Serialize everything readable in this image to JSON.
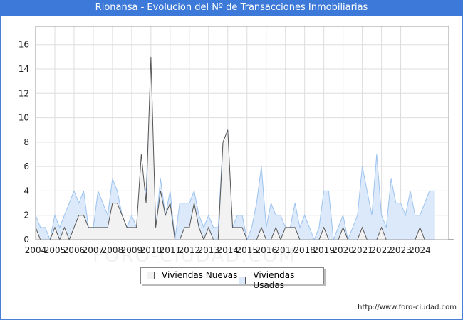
{
  "title": "Rionansa - Evolucion del Nº de Transacciones Inmobiliarias",
  "source": "http://www.foro-ciudad.com",
  "watermark": "FORO-CIUDAD.COM",
  "colors": {
    "title_bg": "#3c79d8",
    "nuevas_fill": "#f2f2f2",
    "nuevas_line": "#555555",
    "usadas_fill": "#dbe9fb",
    "usadas_line": "#9cc3ef",
    "grid": "#dddddd"
  },
  "legend": [
    {
      "label": "Viviendas Nuevas",
      "key": "nuevas"
    },
    {
      "label": "Viviendas Usadas",
      "key": "usadas"
    }
  ],
  "chart_data": {
    "type": "area",
    "title": "Rionansa - Evolucion del Nº de Transacciones Inmobiliarias",
    "xlabel": "",
    "ylabel": "",
    "x_ticks": [
      "2004",
      "2005",
      "2006",
      "2007",
      "2008",
      "2009",
      "2010",
      "2011",
      "2012",
      "2013",
      "2014",
      "2015",
      "2016",
      "2017",
      "2018",
      "2019",
      "2020",
      "2021",
      "2022",
      "2023",
      "2024"
    ],
    "y_ticks": [
      0,
      2,
      4,
      6,
      8,
      10,
      12,
      14,
      16
    ],
    "ylim": [
      0,
      17.5
    ],
    "x_start": "2004Q1",
    "frequency": "quarterly",
    "grid": true,
    "legend_position": "bottom",
    "series": [
      {
        "name": "Viviendas Nuevas",
        "values": [
          1,
          0,
          0,
          0,
          1,
          0,
          1,
          0,
          1,
          2,
          2,
          1,
          1,
          1,
          1,
          1,
          3,
          3,
          2,
          1,
          1,
          1,
          7,
          3,
          15,
          1,
          4,
          2,
          3,
          0,
          0,
          1,
          1,
          3,
          1,
          0,
          1,
          0,
          0,
          8,
          9,
          1,
          1,
          1,
          0,
          0,
          0,
          1,
          0,
          0,
          1,
          0,
          1,
          1,
          1,
          0,
          0,
          0,
          0,
          0,
          1,
          0,
          0,
          0,
          1,
          0,
          0,
          0,
          1,
          0,
          0,
          0,
          1,
          0,
          0,
          0,
          0,
          0,
          0,
          0,
          1,
          0,
          0,
          0,
          0,
          0,
          0,
          0
        ]
      },
      {
        "name": "Viviendas Usadas",
        "values": [
          2,
          1,
          1,
          0,
          2,
          1,
          2,
          3,
          4,
          3,
          4,
          1,
          1,
          4,
          3,
          2,
          5,
          4,
          2,
          1,
          2,
          1,
          5,
          4,
          14,
          1,
          5,
          2,
          4,
          0,
          3,
          3,
          3,
          4,
          2,
          1,
          2,
          1,
          1,
          8,
          9,
          1,
          2,
          2,
          0,
          1,
          3,
          6,
          1,
          3,
          2,
          2,
          1,
          1,
          3,
          1,
          2,
          1,
          0,
          1,
          4,
          4,
          0,
          1,
          2,
          0,
          1,
          2,
          6,
          4,
          2,
          7,
          2,
          1,
          5,
          3,
          3,
          2,
          4,
          2,
          2,
          3,
          4,
          4
        ]
      }
    ]
  }
}
